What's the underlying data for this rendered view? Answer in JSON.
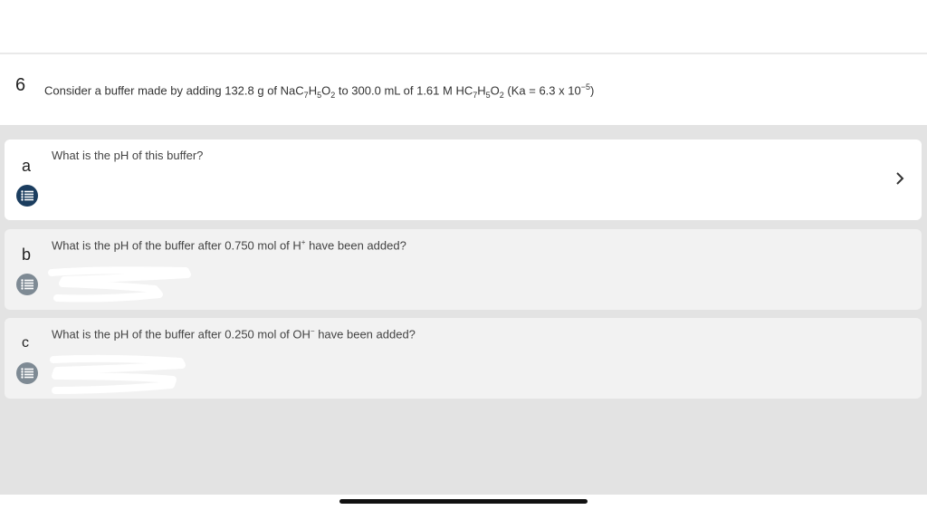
{
  "question": {
    "number": "6",
    "text_prefix": "Consider a buffer made by adding 132.8 g of NaC",
    "sub1": "7",
    "text_h": "H",
    "sub2": "5",
    "text_o": "O",
    "sub3": "2",
    "text_mid": " to 300.0 mL of 1.61 M HC",
    "sub4": "7",
    "text_h2": "H",
    "sub5": "5",
    "text_o2": "O",
    "sub6": "2",
    "text_ka": " (Ka = 6.3 x 10",
    "ka_exp": "−5",
    "text_end": ")"
  },
  "parts": [
    {
      "letter": "a",
      "text": "What is the pH of this buffer?",
      "active": true
    },
    {
      "letter": "b",
      "text_prefix": "What is the pH of the buffer after 0.750 mol of H",
      "sup": "+",
      "text_suffix": " have been added?"
    },
    {
      "letter": "c",
      "text_prefix": "What is the pH of the buffer after 0.250 mol of OH",
      "sup": "−",
      "text_suffix": " have been added?"
    }
  ],
  "icons": {
    "list": "list-icon",
    "chevron": "chevron-right-icon"
  },
  "colors": {
    "active_list_button": "#1b3d5f",
    "inactive_list_button": "#7e8a94",
    "background_gray": "#e3e3e3"
  }
}
